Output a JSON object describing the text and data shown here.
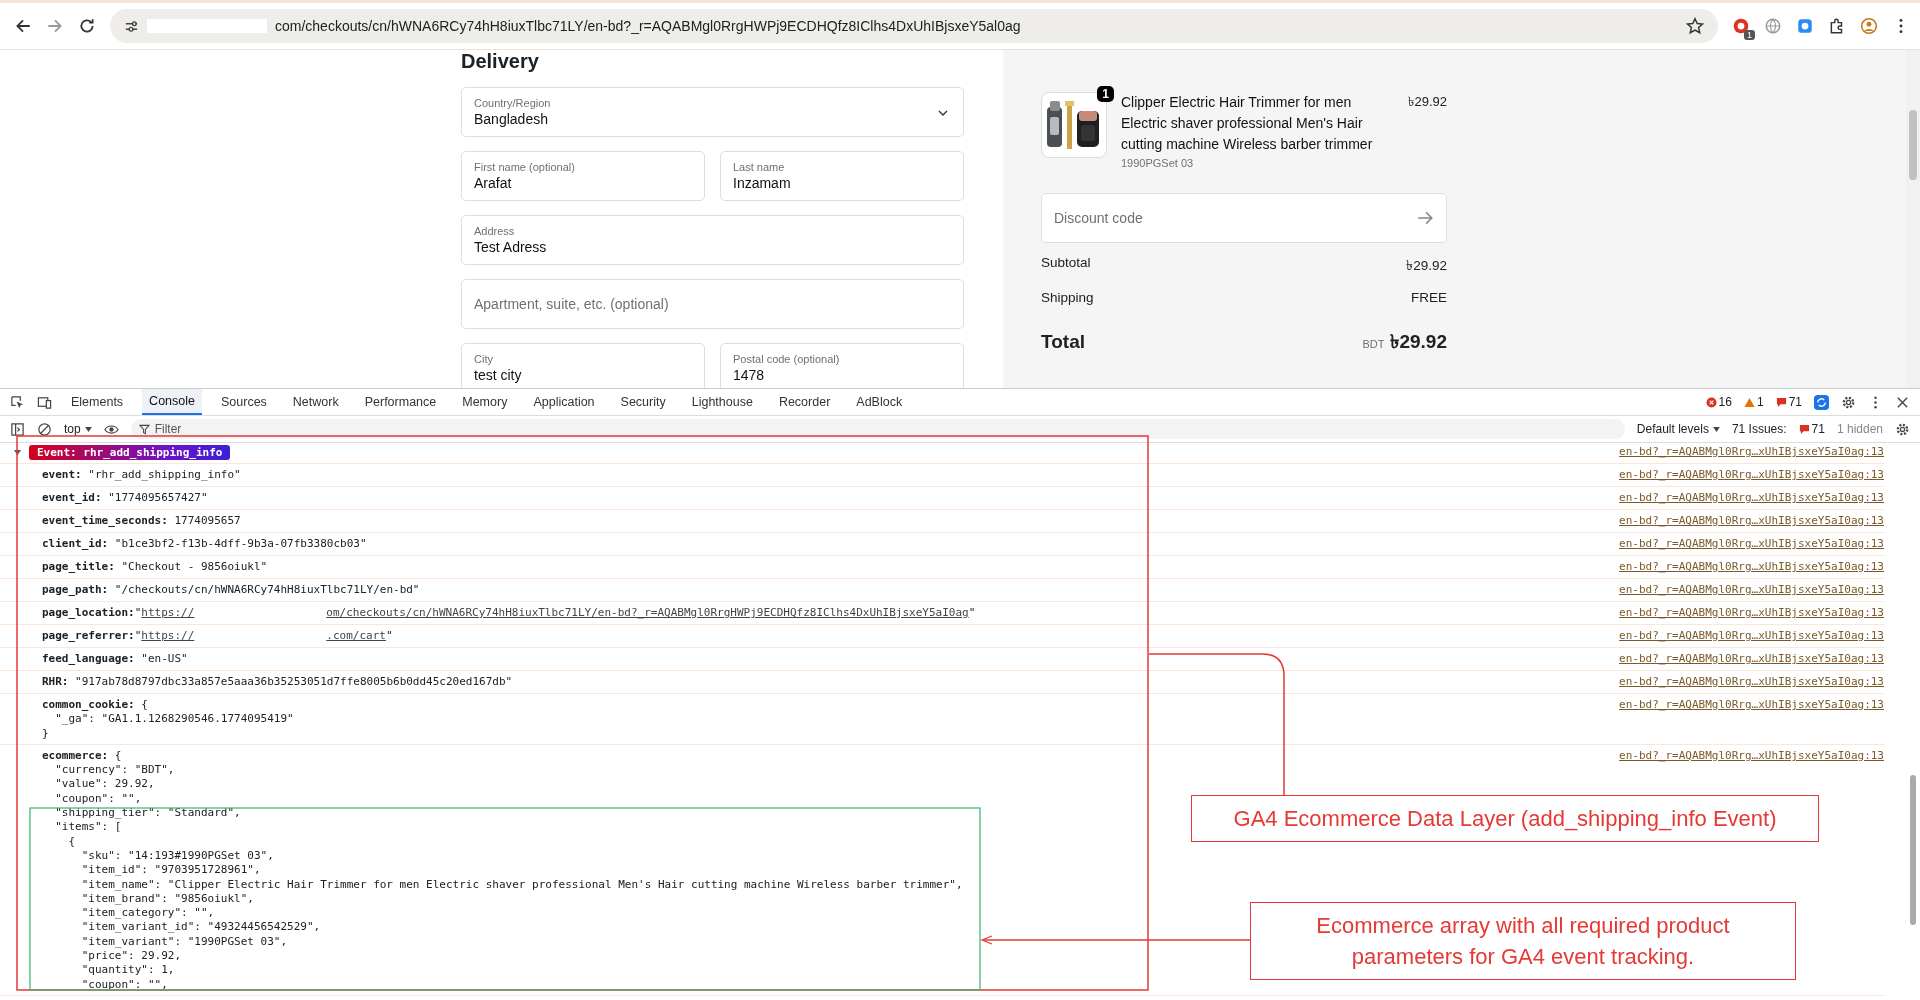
{
  "browser": {
    "url_visible": "com/checkouts/cn/hWNA6RCy74hH8iuxTlbc71LY/en-bd?_r=AQABMgl0RrgHWPj9ECDHQfz8IClhs4DxUhIBjsxeY5al0ag",
    "extension_badge": "1"
  },
  "checkout": {
    "heading": "Delivery",
    "rows": [
      [
        {
          "label": "Country/Region",
          "value": "Bangladesh",
          "kind": "select"
        }
      ],
      [
        {
          "label": "First name (optional)",
          "value": "Arafat",
          "kind": "text"
        },
        {
          "label": "Last name",
          "value": "Inzamam",
          "kind": "text"
        }
      ],
      [
        {
          "label": "Address",
          "value": "Test Adress",
          "kind": "text"
        }
      ],
      [
        {
          "placeholder": "Apartment, suite, etc. (optional)",
          "kind": "empty"
        }
      ],
      [
        {
          "label": "City",
          "value": "test city",
          "kind": "text"
        },
        {
          "label": "Postal code (optional)",
          "value": "1478",
          "kind": "text"
        }
      ]
    ]
  },
  "summary": {
    "product": {
      "quantity": "1",
      "name": "Clipper Electric Hair Trimmer for men Electric shaver professional Men's Hair cutting machine Wireless barber trimmer",
      "variant": "1990PGSet 03",
      "price": "৳29.92"
    },
    "discount_placeholder": "Discount code",
    "lines": [
      {
        "label": "Subtotal",
        "value": "৳29.92"
      },
      {
        "label": "Shipping",
        "value": "FREE"
      }
    ],
    "total_label": "Total",
    "currency": "BDT",
    "total": "৳29.92"
  },
  "devtools": {
    "tabs": [
      {
        "label": "Elements",
        "selected": false
      },
      {
        "label": "Console",
        "selected": true
      },
      {
        "label": "Sources",
        "selected": false
      },
      {
        "label": "Network",
        "selected": false
      },
      {
        "label": "Performance",
        "selected": false
      },
      {
        "label": "Memory",
        "selected": false
      },
      {
        "label": "Application",
        "selected": false
      },
      {
        "label": "Security",
        "selected": false
      },
      {
        "label": "Lighthouse",
        "selected": false
      },
      {
        "label": "Recorder",
        "selected": false
      },
      {
        "label": "AdBlock",
        "selected": false
      }
    ],
    "errors": "16",
    "warnings": "1",
    "messages": "71",
    "context": "top",
    "filter_placeholder": "Filter",
    "levels": "Default levels",
    "issues_label": "71 Issues:",
    "issues_count": "71",
    "hidden": "1 hidden"
  },
  "console": {
    "badge": "Event: rhr_add_shipping_info",
    "badge_source": "en-bd?_r=AQABMgl0Rrg…xUhIBjsxeY5aI0ag:13",
    "entries": [
      {
        "kind": "text",
        "lines": [
          "**event:** \"rhr_add_shipping_info\""
        ],
        "source": "en-bd?_r=AQABMgl0Rrg…xUhIBjsxeY5aI0ag:13"
      },
      {
        "kind": "text",
        "lines": [
          "**event_id:** \"1774095657427\""
        ],
        "source": "en-bd?_r=AQABMgl0Rrg…xUhIBjsxeY5aI0ag:13"
      },
      {
        "kind": "text",
        "lines": [
          "**event_time_seconds:** 1774095657"
        ],
        "source": "en-bd?_r=AQABMgl0Rrg…xUhIBjsxeY5aI0ag:13"
      },
      {
        "kind": "text",
        "lines": [
          "**client_id:** \"b1ce3bf2-f13b-4dff-9b3a-07fb3380cb03\""
        ],
        "source": "en-bd?_r=AQABMgl0Rrg…xUhIBjsxeY5aI0ag:13"
      },
      {
        "kind": "text",
        "lines": [
          "**page_title:** \"Checkout - 9856oiukl\""
        ],
        "source": "en-bd?_r=AQABMgl0Rrg…xUhIBjsxeY5aI0ag:13"
      },
      {
        "kind": "text",
        "lines": [
          "**page_path:** \"/checkouts/cn/hWNA6RCy74hH8iuxTlbc71LY/en-bd\""
        ],
        "source": "en-bd?_r=AQABMgl0Rrg…xUhIBjsxeY5aI0ag:13"
      },
      {
        "kind": "url",
        "key": "page_location:",
        "quote": "\"",
        "url_start": "https://",
        "url_end": "om/checkouts/cn/hWNA6RCy74hH8iuxTlbc71LY/en-bd?_r=AQABMgl0RrgHWPj9ECDHQfz8IClhs4DxUhIBjsxeY5aI0ag",
        "source": "en-bd?_r=AQABMgl0Rrg…xUhIBjsxeY5aI0ag:13"
      },
      {
        "kind": "url",
        "key": "page_referrer:",
        "quote": "\"",
        "url_start": "https://",
        "url_end": ".com/cart",
        "source": "en-bd?_r=AQABMgl0Rrg…xUhIBjsxeY5aI0ag:13"
      },
      {
        "kind": "text",
        "lines": [
          "**feed_language:** \"en-US\""
        ],
        "source": "en-bd?_r=AQABMgl0Rrg…xUhIBjsxeY5aI0ag:13"
      },
      {
        "kind": "text",
        "lines": [
          "**RHR:** \"917ab78d8797dbc33a857e5aaa36b35253051d7ffe8005b6b0dd45c20ed167db\""
        ],
        "source": "en-bd?_r=AQABMgl0Rrg…xUhIBjsxeY5aI0ag:13"
      },
      {
        "kind": "text",
        "lines": [
          "**common_cookie:** {",
          "  \"_ga\": \"GA1.1.1268290546.1774095419\"",
          "}"
        ],
        "source": "en-bd?_r=AQABMgl0Rrg…xUhIBjsxeY5aI0ag:13"
      },
      {
        "kind": "text",
        "lines": [
          "**ecommerce:** {",
          "  \"currency\": \"BDT\",",
          "  \"value\": 29.92,",
          "  \"coupon\": \"\",",
          "  \"shipping_tier\": \"Standard\",",
          "  \"items\": [",
          "    {",
          "      \"sku\": \"14:193#1990PGSet 03\",",
          "      \"item_id\": \"9703951728961\",",
          "      \"item_name\": \"Clipper Electric Hair Trimmer for men Electric shaver professional Men's Hair cutting machine Wireless barber trimmer\",",
          "      \"item_brand\": \"9856oiukl\",",
          "      \"item_category\": \"\",",
          "      \"item_variant_id\": \"49324456542529\",",
          "      \"item_variant\": \"1990PGSet 03\",",
          "      \"price\": 29.92,",
          "      \"quantity\": 1,",
          "      \"coupon\": \"\","
        ],
        "source": "en-bd?_r=AQABMgl0Rrg…xUhIBjsxeY5aI0ag:13"
      }
    ]
  },
  "annotations": [
    "GA4 Ecommerce Data Layer (add_shipping_info Event)",
    "Ecommerce array with all required product parameters for GA4 event tracking."
  ]
}
